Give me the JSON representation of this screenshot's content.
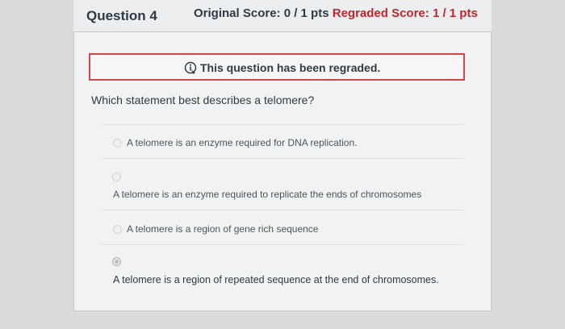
{
  "question": {
    "title": "Question 4",
    "original_score": "Original Score: 0 / 1 pts",
    "regraded_score": "Regraded Score: 1 / 1 pts"
  },
  "notice": {
    "text": "This question has been regraded.",
    "icon": "info-icon"
  },
  "prompt": "Which statement best describes a telomere?",
  "options": [
    {
      "label": "A telomere is an enzyme required for DNA replication.",
      "selected": false
    },
    {
      "label": "A telomere is an enzyme required to replicate the ends of chromosomes",
      "selected": false
    },
    {
      "label": "A telomere is a region of gene rich sequence",
      "selected": false
    },
    {
      "label": "A telomere is a region of repeated sequence at the end of chromosomes.",
      "selected": true
    }
  ],
  "colors": {
    "regraded_score": "#c1272d",
    "notice_border": "#d7464a"
  }
}
